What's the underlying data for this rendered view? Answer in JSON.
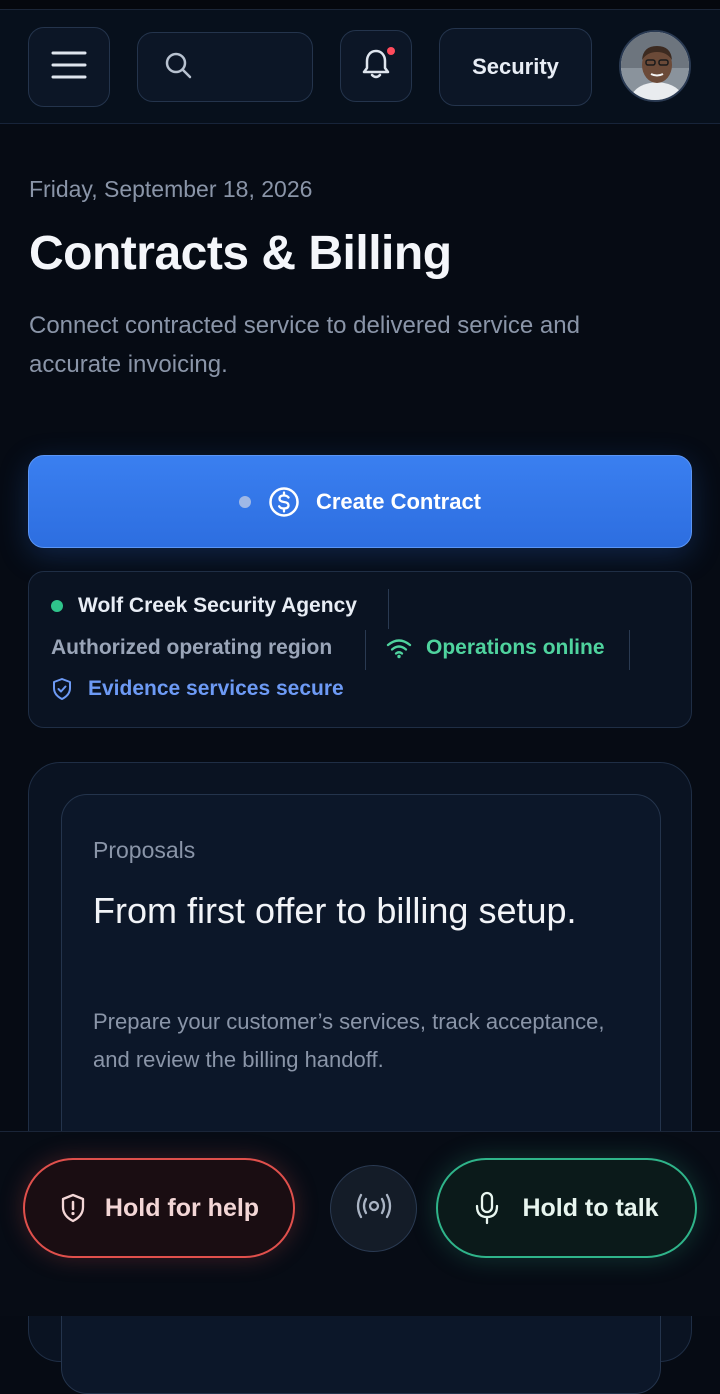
{
  "header": {
    "search_placeholder": "",
    "security_label": "Security",
    "notification_unread": true
  },
  "page": {
    "date": "Friday, September 18, 2026",
    "title": "Contracts & Billing",
    "subtitle": "Connect contracted service to delivered service and accurate invoicing."
  },
  "actions": {
    "create_contract_label": "Create Contract"
  },
  "status": {
    "agency": "Wolf Creek Security Agency",
    "region": "Authorized operating region",
    "operations": "Operations online",
    "evidence": "Evidence services secure"
  },
  "proposals": {
    "label": "Proposals",
    "headline": "From first offer to billing setup.",
    "description": "Prepare your customer’s services, track acceptance, and review the billing handoff."
  },
  "bottom_bar": {
    "help_label": "Hold for help",
    "talk_label": "Hold to talk"
  },
  "colors": {
    "accent_blue": "#3a7ff0",
    "online_green": "#4fd39e",
    "evidence_blue": "#6d9af5",
    "alert_red": "#e0504c"
  },
  "icons": {
    "menu": "menu-icon",
    "search": "search-icon",
    "bell": "bell-icon",
    "dollar": "dollar-circle-icon",
    "wifi": "wifi-icon",
    "shield_check": "shield-check-icon",
    "shield_alert": "shield-alert-icon",
    "broadcast": "broadcast-icon",
    "microphone": "microphone-icon"
  }
}
